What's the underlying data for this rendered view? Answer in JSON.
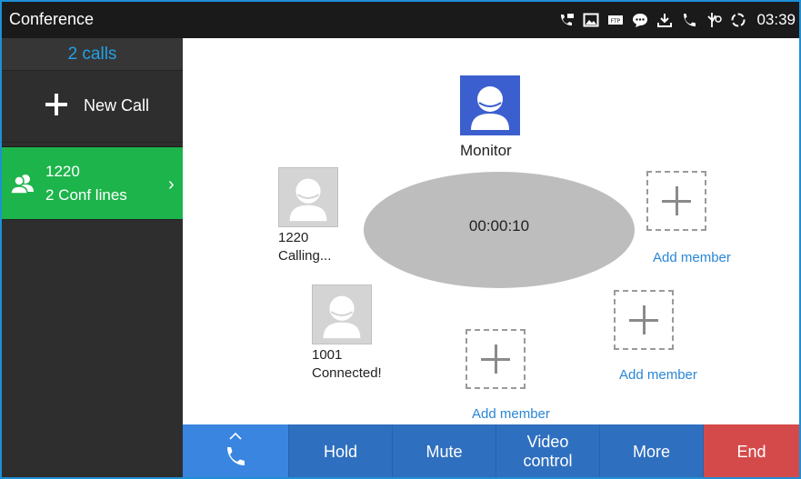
{
  "statusbar": {
    "title": "Conference",
    "time": "03:39",
    "icons": [
      "voicemail-icon",
      "image-icon",
      "ftp-icon",
      "chat-icon",
      "download-icon",
      "phone-icon",
      "usb-icon",
      "sync-icon"
    ]
  },
  "sidebar": {
    "calls_count": "2 calls",
    "new_call_label": "New Call",
    "conference": {
      "number": "1220",
      "lines": "2 Conf lines"
    }
  },
  "main": {
    "timer": "00:00:10",
    "monitor_label": "Monitor",
    "members": [
      {
        "number": "1220",
        "status": "Calling..."
      },
      {
        "number": "1001",
        "status": "Connected!"
      }
    ],
    "add_member_label": "Add member"
  },
  "actions": {
    "hold": "Hold",
    "mute": "Mute",
    "video_line1": "Video",
    "video_line2": "control",
    "more": "More",
    "end": "End"
  },
  "colors": {
    "accent_blue": "#2f6fbf",
    "call_green": "#1db44b",
    "end_red": "#d44a4a",
    "count_blue": "#23a0e6",
    "monitor_blue": "#3c5fcf"
  }
}
